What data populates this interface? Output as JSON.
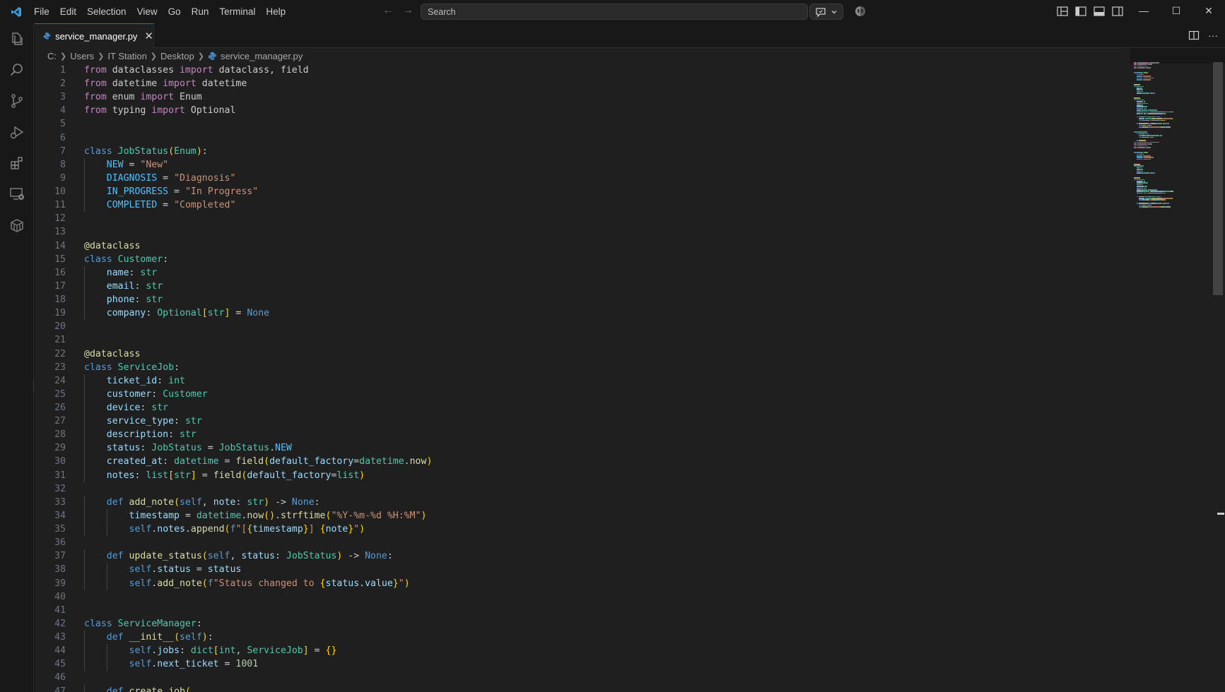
{
  "menu": [
    "File",
    "Edit",
    "Selection",
    "View",
    "Go",
    "Run",
    "Terminal",
    "Help"
  ],
  "search": {
    "placeholder": "Search"
  },
  "tab": {
    "label": "service_manager.py",
    "close": "✕"
  },
  "breadcrumb": [
    "C:",
    "Users",
    "IT Station",
    "Desktop",
    "service_manager.py"
  ],
  "colors": {
    "background": "#1f1f1f",
    "keyword": "#c586c0",
    "function": "#dcdcaa",
    "class": "#4ec9b0",
    "string": "#ce9178",
    "accent": "#0078d4"
  },
  "icons": {
    "activity": [
      "explorer-icon",
      "search-icon",
      "source-control-icon",
      "run-debug-icon",
      "extensions-icon",
      "remote-explorer-icon",
      "containers-icon"
    ]
  },
  "code": [
    [
      [
        "kw",
        "from"
      ],
      [
        "plain",
        " dataclasses "
      ],
      [
        "kw",
        "import"
      ],
      [
        "plain",
        " dataclass, field"
      ]
    ],
    [
      [
        "kw",
        "from"
      ],
      [
        "plain",
        " datetime "
      ],
      [
        "kw",
        "import"
      ],
      [
        "plain",
        " datetime"
      ]
    ],
    [
      [
        "kw",
        "from"
      ],
      [
        "plain",
        " enum "
      ],
      [
        "kw",
        "import"
      ],
      [
        "plain",
        " Enum"
      ]
    ],
    [
      [
        "kw",
        "from"
      ],
      [
        "plain",
        " typing "
      ],
      [
        "kw",
        "import"
      ],
      [
        "plain",
        " Optional"
      ]
    ],
    [],
    [],
    [
      [
        "kd",
        "class"
      ],
      [
        "plain",
        " "
      ],
      [
        "cls",
        "JobStatus"
      ],
      [
        "br1",
        "("
      ],
      [
        "cls",
        "Enum"
      ],
      [
        "br1",
        ")"
      ],
      [
        "plain",
        ":"
      ]
    ],
    [
      [
        "plain",
        "    "
      ],
      [
        "cst",
        "NEW"
      ],
      [
        "plain",
        " = "
      ],
      [
        "str",
        "\"New\""
      ]
    ],
    [
      [
        "plain",
        "    "
      ],
      [
        "cst",
        "DIAGNOSIS"
      ],
      [
        "plain",
        " = "
      ],
      [
        "str",
        "\"Diagnosis\""
      ]
    ],
    [
      [
        "plain",
        "    "
      ],
      [
        "cst",
        "IN_PROGRESS"
      ],
      [
        "plain",
        " = "
      ],
      [
        "str",
        "\"In Progress\""
      ]
    ],
    [
      [
        "plain",
        "    "
      ],
      [
        "cst",
        "COMPLETED"
      ],
      [
        "plain",
        " = "
      ],
      [
        "str",
        "\"Completed\""
      ]
    ],
    [],
    [],
    [
      [
        "dec",
        "@dataclass"
      ]
    ],
    [
      [
        "kd",
        "class"
      ],
      [
        "plain",
        " "
      ],
      [
        "cls",
        "Customer"
      ],
      [
        "plain",
        ":"
      ]
    ],
    [
      [
        "plain",
        "    "
      ],
      [
        "var",
        "name"
      ],
      [
        "plain",
        ": "
      ],
      [
        "cls",
        "str"
      ]
    ],
    [
      [
        "plain",
        "    "
      ],
      [
        "var",
        "email"
      ],
      [
        "plain",
        ": "
      ],
      [
        "cls",
        "str"
      ]
    ],
    [
      [
        "plain",
        "    "
      ],
      [
        "var",
        "phone"
      ],
      [
        "plain",
        ": "
      ],
      [
        "cls",
        "str"
      ]
    ],
    [
      [
        "plain",
        "    "
      ],
      [
        "var",
        "company"
      ],
      [
        "plain",
        ": "
      ],
      [
        "cls",
        "Optional"
      ],
      [
        "br1",
        "["
      ],
      [
        "cls",
        "str"
      ],
      [
        "br1",
        "]"
      ],
      [
        "plain",
        " = "
      ],
      [
        "kd",
        "None"
      ]
    ],
    [],
    [],
    [
      [
        "dec",
        "@dataclass"
      ]
    ],
    [
      [
        "kd",
        "class"
      ],
      [
        "plain",
        " "
      ],
      [
        "cls",
        "ServiceJob"
      ],
      [
        "plain",
        ":"
      ]
    ],
    [
      [
        "plain",
        "    "
      ],
      [
        "var",
        "ticket_id"
      ],
      [
        "plain",
        ": "
      ],
      [
        "cls",
        "int"
      ]
    ],
    [
      [
        "plain",
        "    "
      ],
      [
        "var",
        "customer"
      ],
      [
        "plain",
        ": "
      ],
      [
        "cls",
        "Customer"
      ]
    ],
    [
      [
        "plain",
        "    "
      ],
      [
        "var",
        "device"
      ],
      [
        "plain",
        ": "
      ],
      [
        "cls",
        "str"
      ]
    ],
    [
      [
        "plain",
        "    "
      ],
      [
        "var",
        "service_type"
      ],
      [
        "plain",
        ": "
      ],
      [
        "cls",
        "str"
      ]
    ],
    [
      [
        "plain",
        "    "
      ],
      [
        "var",
        "description"
      ],
      [
        "plain",
        ": "
      ],
      [
        "cls",
        "str"
      ]
    ],
    [
      [
        "plain",
        "    "
      ],
      [
        "var",
        "status"
      ],
      [
        "plain",
        ": "
      ],
      [
        "cls",
        "JobStatus"
      ],
      [
        "plain",
        " = "
      ],
      [
        "cls",
        "JobStatus"
      ],
      [
        "plain",
        "."
      ],
      [
        "cst",
        "NEW"
      ]
    ],
    [
      [
        "plain",
        "    "
      ],
      [
        "var",
        "created_at"
      ],
      [
        "plain",
        ": "
      ],
      [
        "cls",
        "datetime"
      ],
      [
        "plain",
        " = "
      ],
      [
        "fn",
        "field"
      ],
      [
        "br1",
        "("
      ],
      [
        "var",
        "default_factory"
      ],
      [
        "plain",
        "="
      ],
      [
        "cls",
        "datetime"
      ],
      [
        "plain",
        "."
      ],
      [
        "fn",
        "now"
      ],
      [
        "br1",
        ")"
      ]
    ],
    [
      [
        "plain",
        "    "
      ],
      [
        "var",
        "notes"
      ],
      [
        "plain",
        ": "
      ],
      [
        "cls",
        "list"
      ],
      [
        "br1",
        "["
      ],
      [
        "cls",
        "str"
      ],
      [
        "br1",
        "]"
      ],
      [
        "plain",
        " = "
      ],
      [
        "fn",
        "field"
      ],
      [
        "br1",
        "("
      ],
      [
        "var",
        "default_factory"
      ],
      [
        "plain",
        "="
      ],
      [
        "cls",
        "list"
      ],
      [
        "br1",
        ")"
      ]
    ],
    [],
    [
      [
        "plain",
        "    "
      ],
      [
        "kd",
        "def"
      ],
      [
        "plain",
        " "
      ],
      [
        "fn",
        "add_note"
      ],
      [
        "br1",
        "("
      ],
      [
        "self",
        "self"
      ],
      [
        "plain",
        ", "
      ],
      [
        "var",
        "note"
      ],
      [
        "plain",
        ": "
      ],
      [
        "cls",
        "str"
      ],
      [
        "br1",
        ")"
      ],
      [
        "plain",
        " -> "
      ],
      [
        "kd",
        "None"
      ],
      [
        "plain",
        ":"
      ]
    ],
    [
      [
        "plain",
        "        "
      ],
      [
        "var",
        "timestamp"
      ],
      [
        "plain",
        " = "
      ],
      [
        "cls",
        "datetime"
      ],
      [
        "plain",
        "."
      ],
      [
        "fn",
        "now"
      ],
      [
        "br1",
        "()"
      ],
      [
        "plain",
        "."
      ],
      [
        "fn",
        "strftime"
      ],
      [
        "br1",
        "("
      ],
      [
        "str",
        "\"%Y-%m-%d %H:%M\""
      ],
      [
        "br1",
        ")"
      ]
    ],
    [
      [
        "plain",
        "        "
      ],
      [
        "self",
        "self"
      ],
      [
        "plain",
        "."
      ],
      [
        "var",
        "notes"
      ],
      [
        "plain",
        "."
      ],
      [
        "fn",
        "append"
      ],
      [
        "br1",
        "("
      ],
      [
        "kd",
        "f"
      ],
      [
        "str",
        "\"["
      ],
      [
        "br1",
        "{"
      ],
      [
        "var",
        "timestamp"
      ],
      [
        "br1",
        "}"
      ],
      [
        "str",
        "] "
      ],
      [
        "br1",
        "{"
      ],
      [
        "var",
        "note"
      ],
      [
        "br1",
        "}"
      ],
      [
        "str",
        "\""
      ],
      [
        "br1",
        ")"
      ]
    ],
    [],
    [
      [
        "plain",
        "    "
      ],
      [
        "kd",
        "def"
      ],
      [
        "plain",
        " "
      ],
      [
        "fn",
        "update_status"
      ],
      [
        "br1",
        "("
      ],
      [
        "self",
        "self"
      ],
      [
        "plain",
        ", "
      ],
      [
        "var",
        "status"
      ],
      [
        "plain",
        ": "
      ],
      [
        "cls",
        "JobStatus"
      ],
      [
        "br1",
        ")"
      ],
      [
        "plain",
        " -> "
      ],
      [
        "kd",
        "None"
      ],
      [
        "plain",
        ":"
      ]
    ],
    [
      [
        "plain",
        "        "
      ],
      [
        "self",
        "self"
      ],
      [
        "plain",
        "."
      ],
      [
        "var",
        "status"
      ],
      [
        "plain",
        " = "
      ],
      [
        "var",
        "status"
      ]
    ],
    [
      [
        "plain",
        "        "
      ],
      [
        "self",
        "self"
      ],
      [
        "plain",
        "."
      ],
      [
        "fn",
        "add_note"
      ],
      [
        "br1",
        "("
      ],
      [
        "kd",
        "f"
      ],
      [
        "str",
        "\"Status changed to "
      ],
      [
        "br1",
        "{"
      ],
      [
        "var",
        "status"
      ],
      [
        "plain",
        "."
      ],
      [
        "var",
        "value"
      ],
      [
        "br1",
        "}"
      ],
      [
        "str",
        "\""
      ],
      [
        "br1",
        ")"
      ]
    ],
    [],
    [],
    [
      [
        "kd",
        "class"
      ],
      [
        "plain",
        " "
      ],
      [
        "cls",
        "ServiceManager"
      ],
      [
        "plain",
        ":"
      ]
    ],
    [
      [
        "plain",
        "    "
      ],
      [
        "kd",
        "def"
      ],
      [
        "plain",
        " "
      ],
      [
        "fn",
        "__init__"
      ],
      [
        "br1",
        "("
      ],
      [
        "self",
        "self"
      ],
      [
        "br1",
        ")"
      ],
      [
        "plain",
        ":"
      ]
    ],
    [
      [
        "plain",
        "        "
      ],
      [
        "self",
        "self"
      ],
      [
        "plain",
        "."
      ],
      [
        "var",
        "jobs"
      ],
      [
        "plain",
        ": "
      ],
      [
        "cls",
        "dict"
      ],
      [
        "br1",
        "["
      ],
      [
        "cls",
        "int"
      ],
      [
        "plain",
        ", "
      ],
      [
        "cls",
        "ServiceJob"
      ],
      [
        "br1",
        "]"
      ],
      [
        "plain",
        " = "
      ],
      [
        "br1",
        "{}"
      ]
    ],
    [
      [
        "plain",
        "        "
      ],
      [
        "self",
        "self"
      ],
      [
        "plain",
        "."
      ],
      [
        "var",
        "next_ticket"
      ],
      [
        "plain",
        " = "
      ],
      [
        "num",
        "1001"
      ]
    ],
    [],
    [
      [
        "plain",
        "    "
      ],
      [
        "kd",
        "def"
      ],
      [
        "plain",
        " "
      ],
      [
        "fn",
        "create_job"
      ],
      [
        "br1",
        "("
      ]
    ]
  ]
}
